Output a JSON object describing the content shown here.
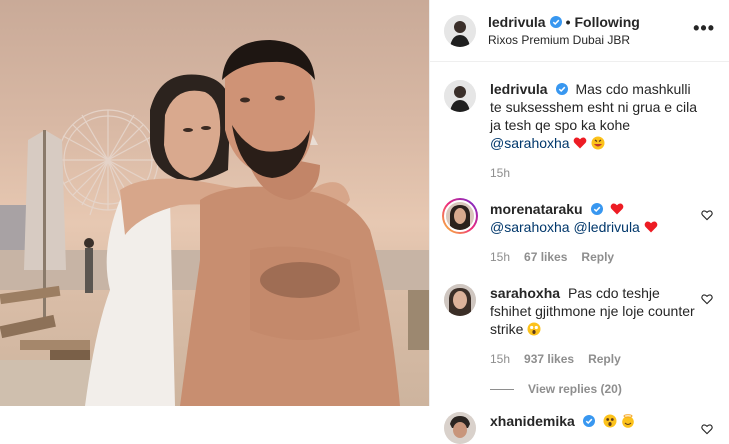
{
  "header": {
    "username": "ledrivula",
    "follow_label": "Following",
    "location": "Rixos Premium Dubai JBR",
    "more_label": "•••"
  },
  "caption": {
    "username": "ledrivula",
    "text": "Mas cdo mashkulli te suksesshem esht ni grua e cila ja tesh qe spo ka kohe",
    "mention": "@sarahoxha",
    "time": "15h"
  },
  "comments": [
    {
      "username": "morenataraku",
      "mention1": "@sarahoxha",
      "mention2": "@ledrivula",
      "time": "15h",
      "likes": "67 likes",
      "reply_label": "Reply"
    },
    {
      "username": "sarahoxha",
      "text": "Pas cdo teshje fshihet gjithmone nje loje counter strike",
      "time": "15h",
      "likes": "937 likes",
      "reply_label": "Reply",
      "view_replies": "View replies (20)"
    },
    {
      "username": "xhanidemika"
    }
  ],
  "colors": {
    "verified": "#3897f0",
    "heart_red": "#ed1c24",
    "link": "#00376b",
    "muted": "#8e8e8e"
  },
  "icons": [
    "verified-badge-icon",
    "more-options-icon",
    "like-heart-icon",
    "red-heart-emoji",
    "grin-emoji",
    "shocked-emoji",
    "angel-emoji"
  ]
}
